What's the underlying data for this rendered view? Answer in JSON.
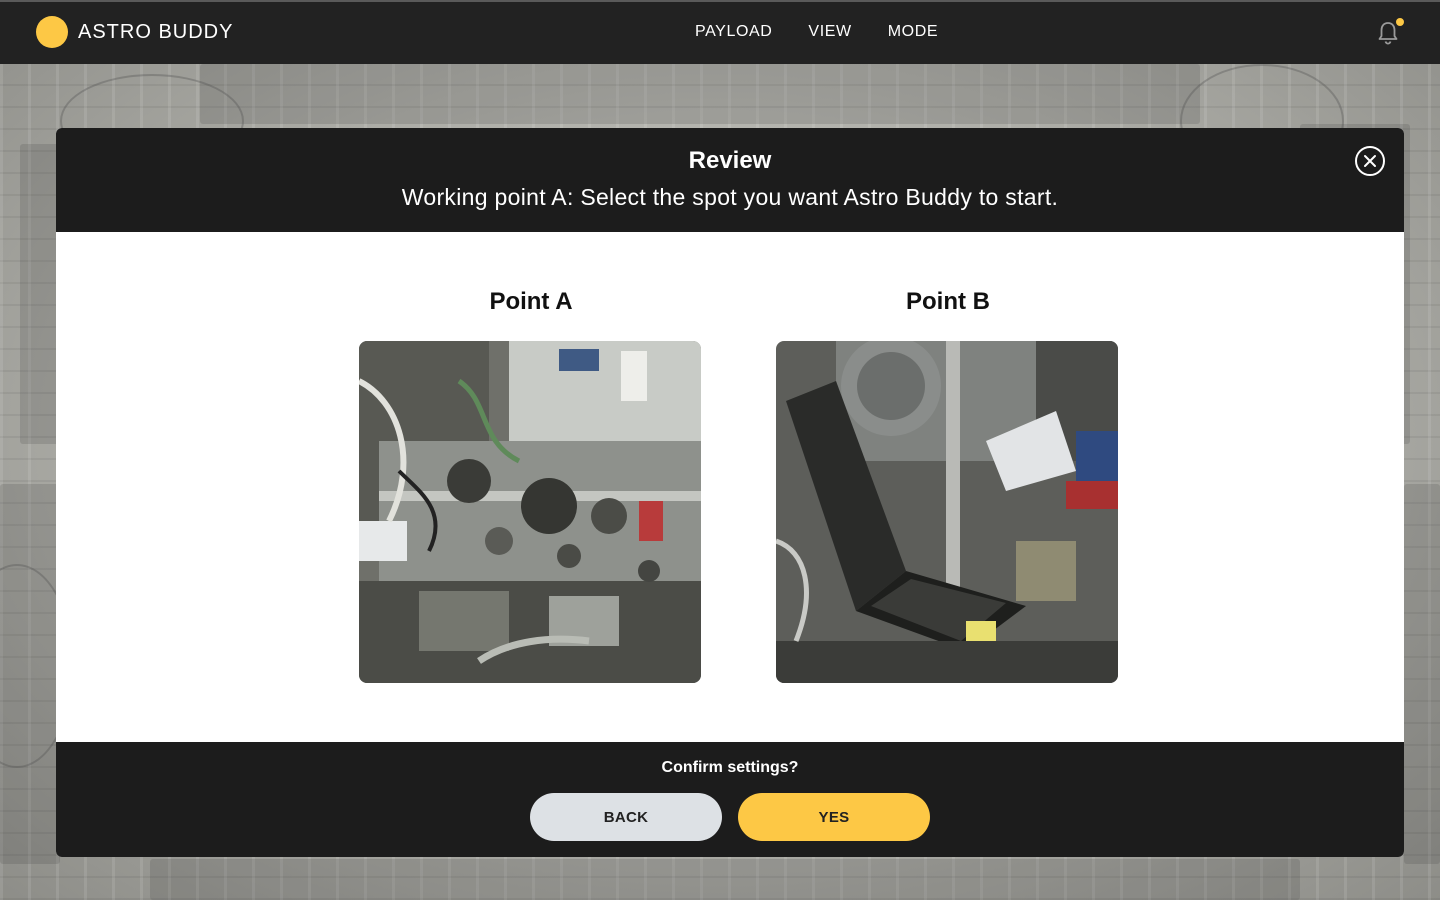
{
  "app": {
    "title": "ASTRO BUDDY",
    "logo_color": "#fdc845",
    "accent_color": "#fdc845"
  },
  "nav": {
    "items": [
      {
        "label": "PAYLOAD"
      },
      {
        "label": "VIEW"
      },
      {
        "label": "MODE"
      }
    ]
  },
  "notifications": {
    "icon": "bell-icon",
    "has_unread": true
  },
  "modal": {
    "title": "Review",
    "subtitle": "Working point A: Select the spot you want Astro Buddy to start.",
    "close_icon": "close-icon",
    "points": [
      {
        "label": "Point A",
        "image": "equipment-rack-photo"
      },
      {
        "label": "Point B",
        "image": "laptop-workstation-photo"
      }
    ],
    "confirm_text": "Confirm settings?",
    "back_label": "BACK",
    "yes_label": "YES"
  }
}
